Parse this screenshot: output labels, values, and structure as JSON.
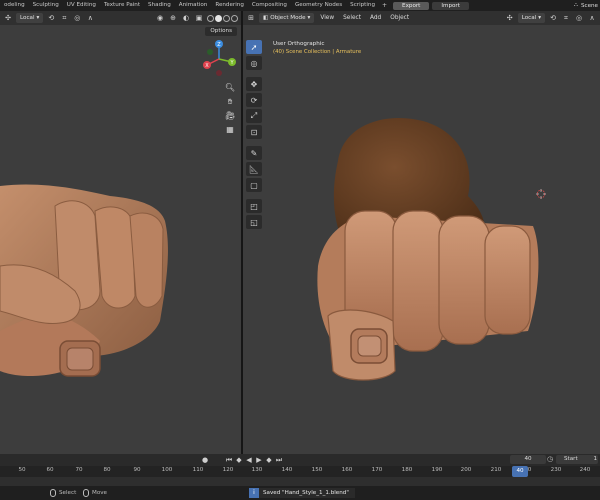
{
  "workspace_tabs": [
    "odeling",
    "Sculpting",
    "UV Editing",
    "Texture Paint",
    "Shading",
    "Animation",
    "Rendering",
    "Compositing",
    "Geometry Nodes",
    "Scripting"
  ],
  "workspace_plus": "+",
  "top_buttons": {
    "export": "Export",
    "import": "Import"
  },
  "scene_label": "Scene",
  "left_header": {
    "orientation": "Local",
    "options": "Options"
  },
  "right_header": {
    "mode": "Object Mode",
    "menus": [
      "View",
      "Select",
      "Add",
      "Object"
    ],
    "orientation": "Local"
  },
  "viewport_info": {
    "view_name": "User Orthographic",
    "collection": "(40) Scene Collection | Armature"
  },
  "gizmo_axes": {
    "z": "Z",
    "y": "Y",
    "x": "X"
  },
  "timeline": {
    "current_frame": "40",
    "start_label": "Start",
    "start_value": "1",
    "ticks": [
      "50",
      "60",
      "70",
      "80",
      "90",
      "100",
      "110",
      "120",
      "130",
      "140",
      "150",
      "160",
      "170",
      "180",
      "190",
      "200",
      "210",
      "220",
      "230",
      "240"
    ],
    "cursor_frame": "40"
  },
  "status": {
    "select": "Select",
    "move": "Move",
    "saved": "Saved \"Hand_Style_1_1.blend\""
  },
  "colors": {
    "active_tool": "#4772b3",
    "skin": "#b88060",
    "axis_x": "#e0424e",
    "axis_y": "#7cbb2c",
    "axis_z": "#3b8de0",
    "collection_text": "#e8c15d"
  }
}
